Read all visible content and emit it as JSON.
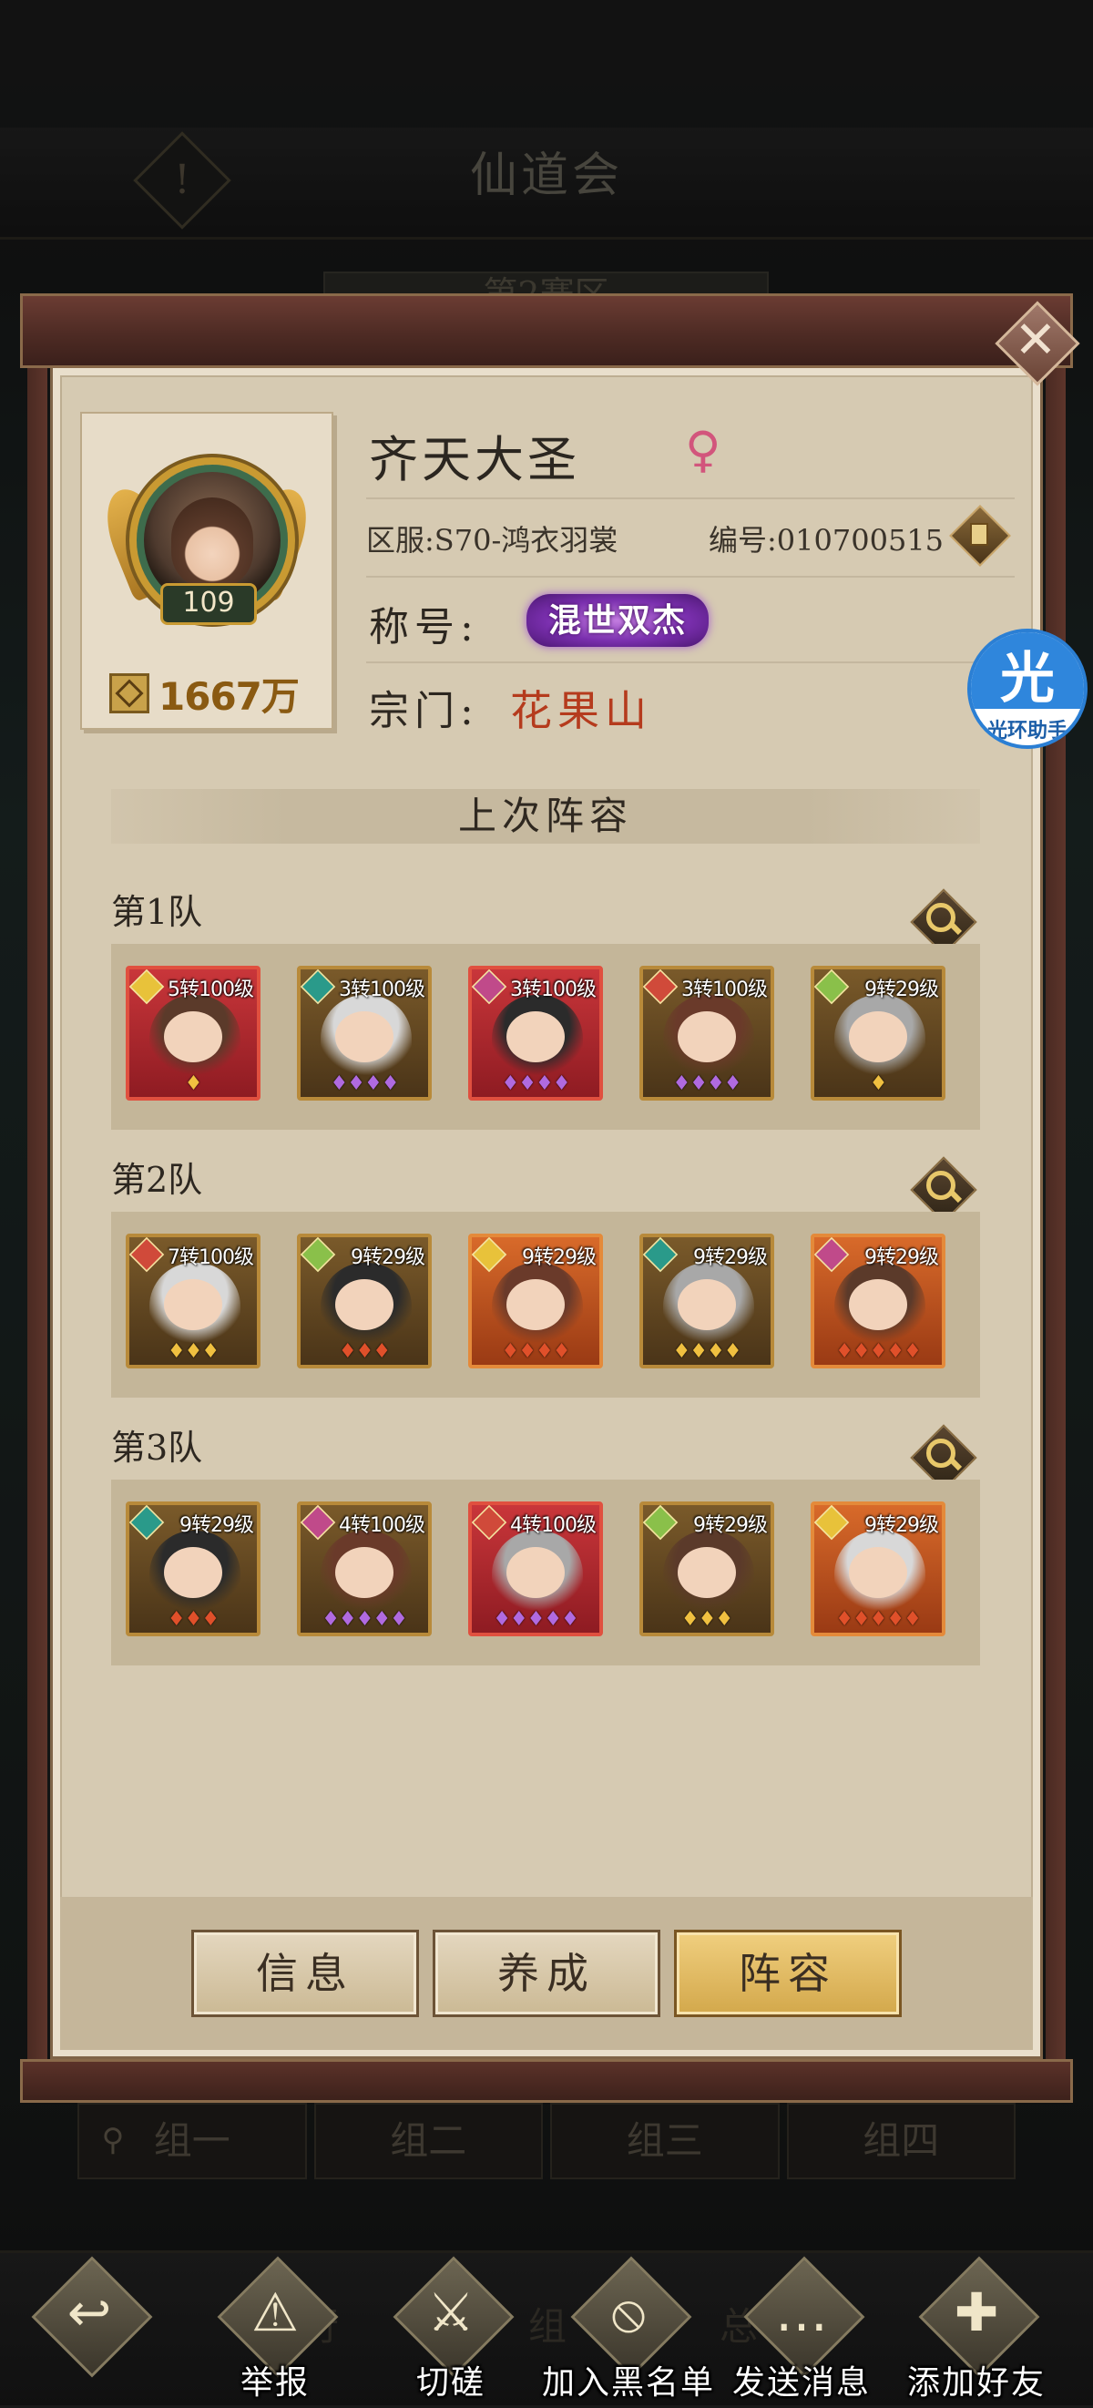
{
  "background": {
    "title": "仙道会",
    "region_tab": "第2赛区",
    "groups": [
      "组一",
      "组二",
      "组三",
      "组四"
    ],
    "under_text": [
      "行",
      "组",
      "总"
    ]
  },
  "profile": {
    "name": "齐天大圣",
    "gender_symbol": "♀",
    "level": "109",
    "power": "1667万",
    "server_label": "区服:",
    "server": "S70-鸿衣羽裳",
    "id_label": "编号:",
    "id": "010700515",
    "title_label": "称号:",
    "title_badge": "混世双杰",
    "sect_label": "宗门:",
    "sect": "花果山"
  },
  "helper": {
    "glyph": "光",
    "caption": "光环助手"
  },
  "lineup": {
    "heading": "上次阵容",
    "teams": [
      {
        "name": "第1队",
        "heroes": [
          {
            "level": "5转100级",
            "frame": "red",
            "stars": 1,
            "star_color": "gold"
          },
          {
            "level": "3转100级",
            "frame": "gold",
            "stars": 4,
            "star_color": "purple"
          },
          {
            "level": "3转100级",
            "frame": "red",
            "stars": 4,
            "star_color": "purple"
          },
          {
            "level": "3转100级",
            "frame": "gold",
            "stars": 4,
            "star_color": "purple"
          },
          {
            "level": "9转29级",
            "frame": "gold",
            "stars": 1,
            "star_color": "gold"
          }
        ]
      },
      {
        "name": "第2队",
        "heroes": [
          {
            "level": "7转100级",
            "frame": "gold",
            "stars": 3,
            "star_color": "gold"
          },
          {
            "level": "9转29级",
            "frame": "gold",
            "stars": 3,
            "star_color": "red"
          },
          {
            "level": "9转29级",
            "frame": "orange",
            "stars": 4,
            "star_color": "red"
          },
          {
            "level": "9转29级",
            "frame": "gold",
            "stars": 4,
            "star_color": "gold"
          },
          {
            "level": "9转29级",
            "frame": "orange",
            "stars": 5,
            "star_color": "red"
          }
        ]
      },
      {
        "name": "第3队",
        "heroes": [
          {
            "level": "9转29级",
            "frame": "gold",
            "stars": 3,
            "star_color": "red"
          },
          {
            "level": "4转100级",
            "frame": "gold",
            "stars": 5,
            "star_color": "purple"
          },
          {
            "level": "4转100级",
            "frame": "red",
            "stars": 5,
            "star_color": "purple"
          },
          {
            "level": "9转29级",
            "frame": "gold",
            "stars": 3,
            "star_color": "gold"
          },
          {
            "level": "9转29级",
            "frame": "orange",
            "stars": 5,
            "star_color": "red"
          }
        ]
      }
    ]
  },
  "dialog_buttons": [
    {
      "label": "信息",
      "active": false
    },
    {
      "label": "养成",
      "active": false
    },
    {
      "label": "阵容",
      "active": true
    }
  ],
  "toolbar": [
    {
      "label": "",
      "icon": "back-arrow-icon"
    },
    {
      "label": "举报",
      "icon": "warning-icon"
    },
    {
      "label": "切磋",
      "icon": "crossed-swords-icon"
    },
    {
      "label": "加入黑名单",
      "icon": "block-user-icon"
    },
    {
      "label": "发送消息",
      "icon": "chat-bubble-icon"
    },
    {
      "label": "添加好友",
      "icon": "add-friend-icon"
    }
  ],
  "colors": {
    "accent_gold": "#d3a84b",
    "sect_red": "#b53b1d",
    "title_purple": "#7a2fae",
    "gender_pink": "#d2557c"
  }
}
